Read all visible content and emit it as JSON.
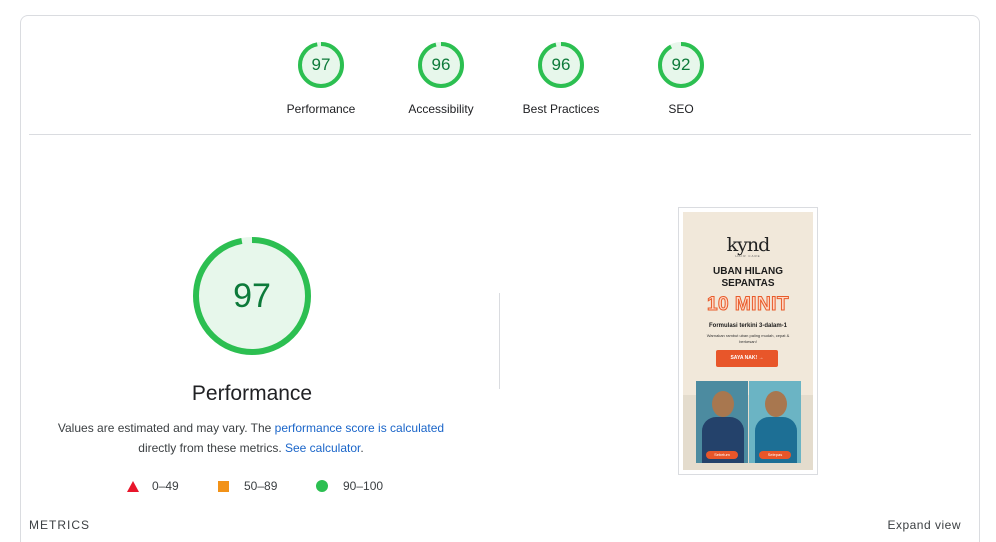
{
  "summary": {
    "gauges": [
      {
        "label": "Performance",
        "score": "97",
        "value": 97
      },
      {
        "label": "Accessibility",
        "score": "96",
        "value": 96
      },
      {
        "label": "Best Practices",
        "score": "96",
        "value": 96
      },
      {
        "label": "SEO",
        "score": "92",
        "value": 92
      }
    ]
  },
  "main": {
    "score": "97",
    "value": 97,
    "title": "Performance",
    "desc_prefix": "Values are estimated and may vary. The ",
    "desc_link1": "performance score is calculated",
    "desc_mid": "directly from these metrics. ",
    "desc_link2": "See calculator",
    "desc_suffix": "."
  },
  "legend": [
    {
      "shape": "triangle-icon",
      "range": "0–49",
      "color": "#e8162b"
    },
    {
      "shape": "square-icon",
      "range": "50–89",
      "color": "#f29218"
    },
    {
      "shape": "circle-icon",
      "range": "90–100",
      "color": "#2cbf51"
    }
  ],
  "screenshot": {
    "brand": "kynd",
    "brand_sub": "HAIR CARE",
    "headline_1": "UBAN HILANG",
    "headline_2": "SEPANTAS",
    "big_text": "10 MINIT",
    "formula": "Formulasi terkini 3-dalam-1",
    "small_text": "Warnakan rambut uban paling mudah, cepat & berkesan!",
    "cta": "SAYA NAK! →",
    "tag_left": "Sebelum",
    "tag_right": "Selepas"
  },
  "footer": {
    "metrics_label": "METRICS",
    "expand_label": "Expand view"
  },
  "colors": {
    "pass_green": "#0d7a3a",
    "gauge_stroke": "#2cbf51",
    "gauge_fill": "#e7f7eb",
    "link": "#1a65c9"
  }
}
